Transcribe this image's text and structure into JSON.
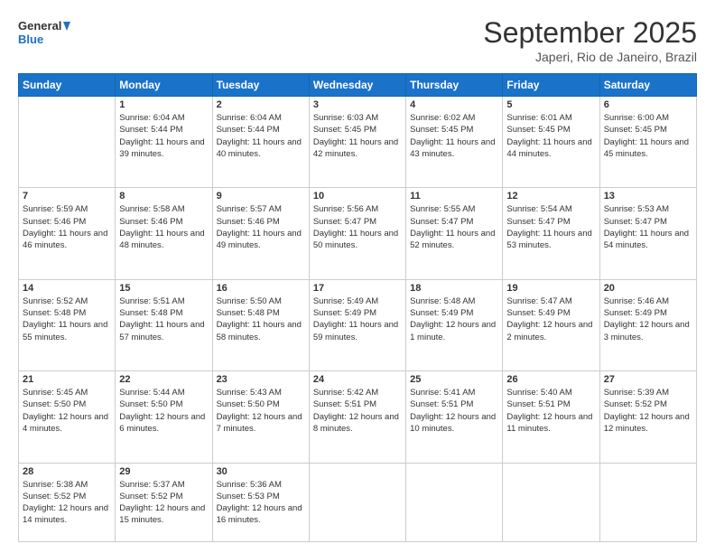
{
  "header": {
    "logo_line1": "General",
    "logo_line2": "Blue",
    "month": "September 2025",
    "location": "Japeri, Rio de Janeiro, Brazil"
  },
  "weekdays": [
    "Sunday",
    "Monday",
    "Tuesday",
    "Wednesday",
    "Thursday",
    "Friday",
    "Saturday"
  ],
  "weeks": [
    [
      {
        "day": "",
        "sunrise": "",
        "sunset": "",
        "daylight": ""
      },
      {
        "day": "1",
        "sunrise": "Sunrise: 6:04 AM",
        "sunset": "Sunset: 5:44 PM",
        "daylight": "Daylight: 11 hours and 39 minutes."
      },
      {
        "day": "2",
        "sunrise": "Sunrise: 6:04 AM",
        "sunset": "Sunset: 5:44 PM",
        "daylight": "Daylight: 11 hours and 40 minutes."
      },
      {
        "day": "3",
        "sunrise": "Sunrise: 6:03 AM",
        "sunset": "Sunset: 5:45 PM",
        "daylight": "Daylight: 11 hours and 42 minutes."
      },
      {
        "day": "4",
        "sunrise": "Sunrise: 6:02 AM",
        "sunset": "Sunset: 5:45 PM",
        "daylight": "Daylight: 11 hours and 43 minutes."
      },
      {
        "day": "5",
        "sunrise": "Sunrise: 6:01 AM",
        "sunset": "Sunset: 5:45 PM",
        "daylight": "Daylight: 11 hours and 44 minutes."
      },
      {
        "day": "6",
        "sunrise": "Sunrise: 6:00 AM",
        "sunset": "Sunset: 5:45 PM",
        "daylight": "Daylight: 11 hours and 45 minutes."
      }
    ],
    [
      {
        "day": "7",
        "sunrise": "Sunrise: 5:59 AM",
        "sunset": "Sunset: 5:46 PM",
        "daylight": "Daylight: 11 hours and 46 minutes."
      },
      {
        "day": "8",
        "sunrise": "Sunrise: 5:58 AM",
        "sunset": "Sunset: 5:46 PM",
        "daylight": "Daylight: 11 hours and 48 minutes."
      },
      {
        "day": "9",
        "sunrise": "Sunrise: 5:57 AM",
        "sunset": "Sunset: 5:46 PM",
        "daylight": "Daylight: 11 hours and 49 minutes."
      },
      {
        "day": "10",
        "sunrise": "Sunrise: 5:56 AM",
        "sunset": "Sunset: 5:47 PM",
        "daylight": "Daylight: 11 hours and 50 minutes."
      },
      {
        "day": "11",
        "sunrise": "Sunrise: 5:55 AM",
        "sunset": "Sunset: 5:47 PM",
        "daylight": "Daylight: 11 hours and 52 minutes."
      },
      {
        "day": "12",
        "sunrise": "Sunrise: 5:54 AM",
        "sunset": "Sunset: 5:47 PM",
        "daylight": "Daylight: 11 hours and 53 minutes."
      },
      {
        "day": "13",
        "sunrise": "Sunrise: 5:53 AM",
        "sunset": "Sunset: 5:47 PM",
        "daylight": "Daylight: 11 hours and 54 minutes."
      }
    ],
    [
      {
        "day": "14",
        "sunrise": "Sunrise: 5:52 AM",
        "sunset": "Sunset: 5:48 PM",
        "daylight": "Daylight: 11 hours and 55 minutes."
      },
      {
        "day": "15",
        "sunrise": "Sunrise: 5:51 AM",
        "sunset": "Sunset: 5:48 PM",
        "daylight": "Daylight: 11 hours and 57 minutes."
      },
      {
        "day": "16",
        "sunrise": "Sunrise: 5:50 AM",
        "sunset": "Sunset: 5:48 PM",
        "daylight": "Daylight: 11 hours and 58 minutes."
      },
      {
        "day": "17",
        "sunrise": "Sunrise: 5:49 AM",
        "sunset": "Sunset: 5:49 PM",
        "daylight": "Daylight: 11 hours and 59 minutes."
      },
      {
        "day": "18",
        "sunrise": "Sunrise: 5:48 AM",
        "sunset": "Sunset: 5:49 PM",
        "daylight": "Daylight: 12 hours and 1 minute."
      },
      {
        "day": "19",
        "sunrise": "Sunrise: 5:47 AM",
        "sunset": "Sunset: 5:49 PM",
        "daylight": "Daylight: 12 hours and 2 minutes."
      },
      {
        "day": "20",
        "sunrise": "Sunrise: 5:46 AM",
        "sunset": "Sunset: 5:49 PM",
        "daylight": "Daylight: 12 hours and 3 minutes."
      }
    ],
    [
      {
        "day": "21",
        "sunrise": "Sunrise: 5:45 AM",
        "sunset": "Sunset: 5:50 PM",
        "daylight": "Daylight: 12 hours and 4 minutes."
      },
      {
        "day": "22",
        "sunrise": "Sunrise: 5:44 AM",
        "sunset": "Sunset: 5:50 PM",
        "daylight": "Daylight: 12 hours and 6 minutes."
      },
      {
        "day": "23",
        "sunrise": "Sunrise: 5:43 AM",
        "sunset": "Sunset: 5:50 PM",
        "daylight": "Daylight: 12 hours and 7 minutes."
      },
      {
        "day": "24",
        "sunrise": "Sunrise: 5:42 AM",
        "sunset": "Sunset: 5:51 PM",
        "daylight": "Daylight: 12 hours and 8 minutes."
      },
      {
        "day": "25",
        "sunrise": "Sunrise: 5:41 AM",
        "sunset": "Sunset: 5:51 PM",
        "daylight": "Daylight: 12 hours and 10 minutes."
      },
      {
        "day": "26",
        "sunrise": "Sunrise: 5:40 AM",
        "sunset": "Sunset: 5:51 PM",
        "daylight": "Daylight: 12 hours and 11 minutes."
      },
      {
        "day": "27",
        "sunrise": "Sunrise: 5:39 AM",
        "sunset": "Sunset: 5:52 PM",
        "daylight": "Daylight: 12 hours and 12 minutes."
      }
    ],
    [
      {
        "day": "28",
        "sunrise": "Sunrise: 5:38 AM",
        "sunset": "Sunset: 5:52 PM",
        "daylight": "Daylight: 12 hours and 14 minutes."
      },
      {
        "day": "29",
        "sunrise": "Sunrise: 5:37 AM",
        "sunset": "Sunset: 5:52 PM",
        "daylight": "Daylight: 12 hours and 15 minutes."
      },
      {
        "day": "30",
        "sunrise": "Sunrise: 5:36 AM",
        "sunset": "Sunset: 5:53 PM",
        "daylight": "Daylight: 12 hours and 16 minutes."
      },
      {
        "day": "",
        "sunrise": "",
        "sunset": "",
        "daylight": ""
      },
      {
        "day": "",
        "sunrise": "",
        "sunset": "",
        "daylight": ""
      },
      {
        "day": "",
        "sunrise": "",
        "sunset": "",
        "daylight": ""
      },
      {
        "day": "",
        "sunrise": "",
        "sunset": "",
        "daylight": ""
      }
    ]
  ]
}
